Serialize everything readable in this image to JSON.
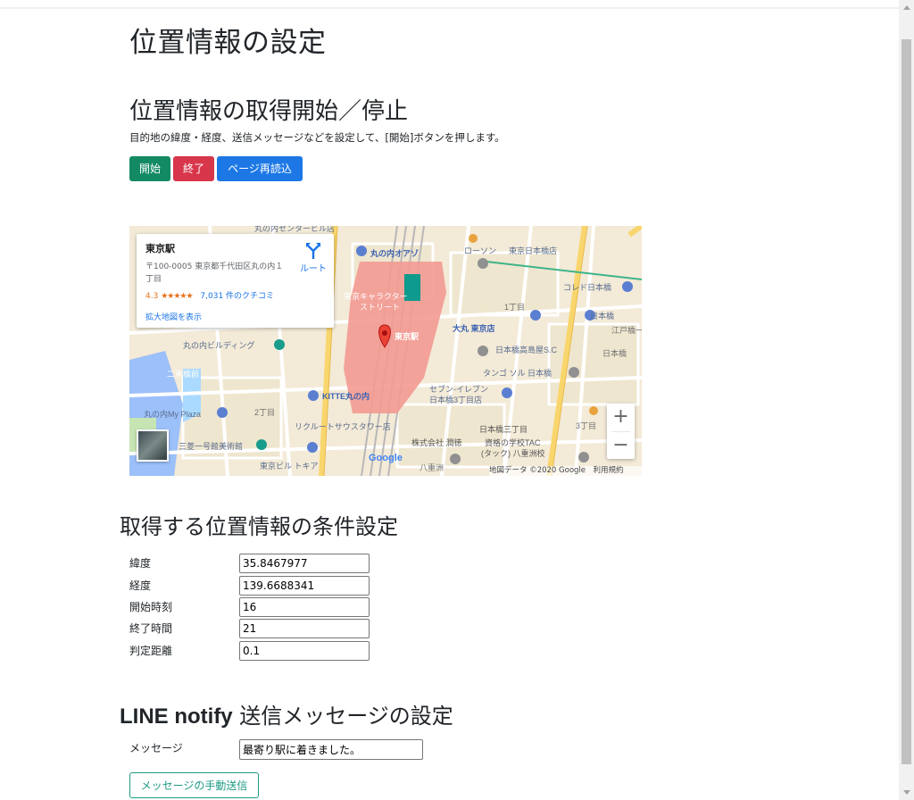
{
  "page": {
    "title": "位置情報の設定"
  },
  "control": {
    "heading": "位置情報の取得開始／停止",
    "description": "目的地の緯度・経度、送信メッセージなどを設定して、[開始]ボタンを押します。",
    "buttons": {
      "start": "開始",
      "stop": "終了",
      "reload": "ページ再読込"
    },
    "colors": {
      "start": "#138a64",
      "stop": "#d8364b",
      "reload": "#1d78e6"
    }
  },
  "map": {
    "place_card": {
      "name": "東京駅",
      "address": "〒100-0005 東京都千代田区丸の内１丁目",
      "rating": "4.3",
      "stars": "★★★★★",
      "reviews": "7,031 件のクチコミ",
      "route_label": "ルート",
      "enlarge_link": "拡大地図を表示"
    },
    "marker_label": "東京駅",
    "labels": {
      "marunouchi_oazo": "丸の内オアゾ",
      "lawson": "ローソン",
      "tokyo_nihonbashi": "東京日本橋店",
      "coredo": "コレド日本橋",
      "nihonbashi": "日本橋",
      "character_street": "東京キャラクター",
      "character_street2": "ストリート",
      "itchome": "1丁目",
      "daimaru": "大丸 東京店",
      "takashimaya": "日本橋高島屋S.C",
      "edobashi": "江戸橋一",
      "marunouchi_bldg": "丸の内ビルディング",
      "nijubashimae": "二重橋前",
      "tangosol": "タンゴ ソル 日本橋",
      "nihonbashi_sta": "日本橋",
      "kitte": "KITTE丸の内",
      "seven": "セブン-イレブン",
      "seven2": "日本橋3丁目店",
      "mymarunouchi": "丸の内My Plaza",
      "nichome": "2丁目",
      "recruit": "リクルートサウスタワー店",
      "sanchome": "日本橋三丁目",
      "mitsubishi": "三菱一号館美術館",
      "kabushiki": "株式会社 潤徳",
      "tac": "資格の学校TAC",
      "tac2": "(タック) 八重洲校",
      "tokyo_building": "東京ビル トキア",
      "yaesu": "八重洲",
      "bldg_top": "丸の内センタービル店",
      "sanchome2": "3丁目"
    },
    "zoom_in": "+",
    "zoom_out": "−",
    "google": "Google",
    "attribution": "地図データ ©2020 Google　利用規約"
  },
  "conditions": {
    "heading": "取得する位置情報の条件設定",
    "fields": [
      {
        "label": "緯度",
        "value": "35.8467977"
      },
      {
        "label": "経度",
        "value": "139.6688341"
      },
      {
        "label": "開始時刻",
        "value": "16"
      },
      {
        "label": "終了時間",
        "value": "21"
      },
      {
        "label": "判定距離",
        "value": "0.1"
      }
    ]
  },
  "line": {
    "heading_bold": "LINE notify",
    "heading_rest": " 送信メッセージの設定",
    "message_label": "メッセージ",
    "message_value": "最寄り駅に着きました。",
    "manual_send": "メッセージの手動送信",
    "accent": "#1f9b86"
  }
}
